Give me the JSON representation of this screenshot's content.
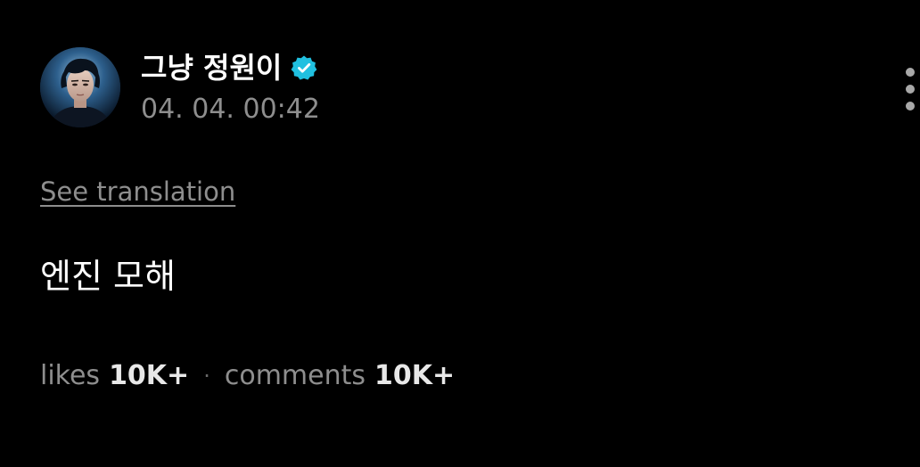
{
  "post": {
    "author": {
      "name": "그냥 정원이",
      "verified": true,
      "verified_color": "#20c0e0",
      "avatar_icon": "profile-photo"
    },
    "timestamp": "04. 04. 00:42",
    "more_icon": "vertical-ellipsis-icon",
    "translate_label": "See translation",
    "body": "엔진 모해",
    "stats": {
      "likes_label": "likes",
      "likes_value": "10K+",
      "separator": "·",
      "comments_label": "comments",
      "comments_value": "10K+"
    }
  }
}
